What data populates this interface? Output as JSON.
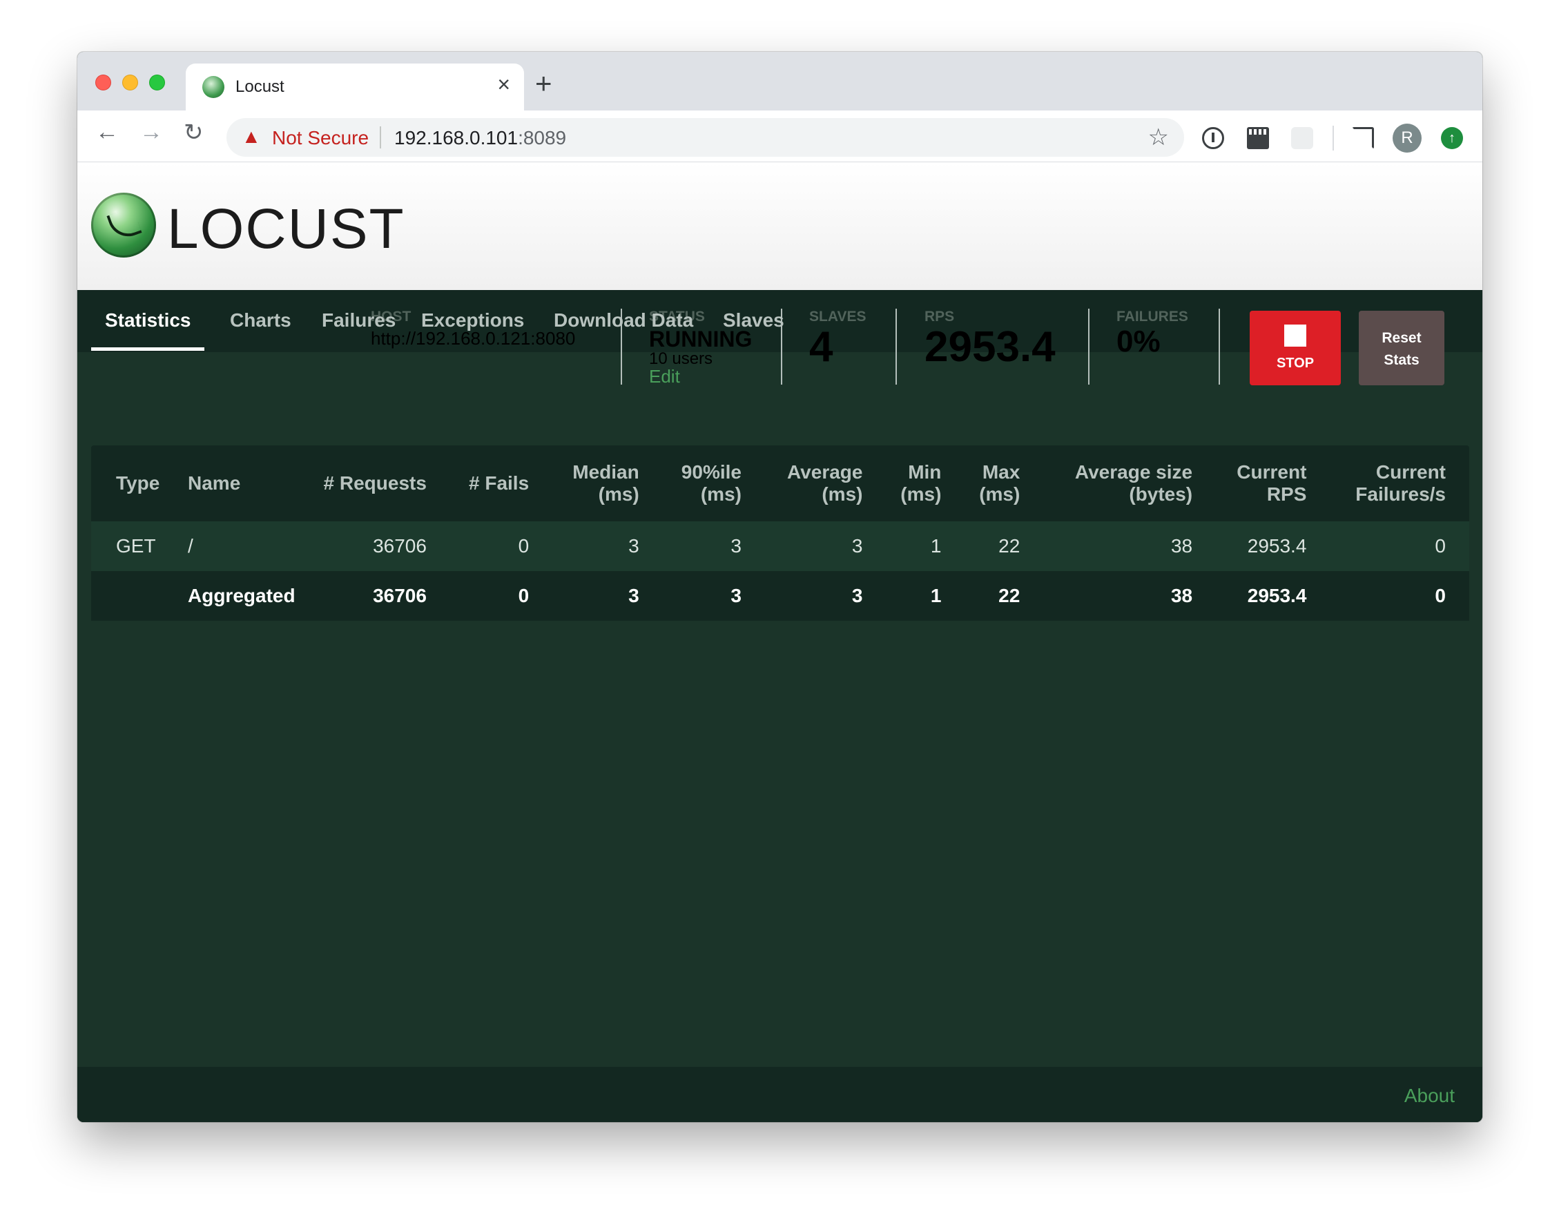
{
  "browser": {
    "tab_title": "Locust",
    "tab_close": "×",
    "new_tab": "+",
    "not_secure": "Not Secure",
    "url_host": "192.168.0.101",
    "url_port": ":8089",
    "avatar_letter": "R"
  },
  "header": {
    "logo_text": "LOCUST",
    "host": {
      "label": "HOST",
      "value": "http://192.168.0.121:8080"
    },
    "status": {
      "label": "STATUS",
      "value": "RUNNING",
      "users": "10 users",
      "edit": "Edit"
    },
    "slaves": {
      "label": "SLAVES",
      "value": "4"
    },
    "rps": {
      "label": "RPS",
      "value": "2953.4"
    },
    "failures": {
      "label": "FAILURES",
      "value": "0%"
    },
    "stop_label": "STOP",
    "reset_label_1": "Reset",
    "reset_label_2": "Stats"
  },
  "tabs": [
    "Statistics",
    "Charts",
    "Failures",
    "Exceptions",
    "Download Data",
    "Slaves"
  ],
  "table": {
    "headers": [
      "Type",
      "Name",
      "# Requests",
      "# Fails",
      "Median (ms)",
      "90%ile (ms)",
      "Average (ms)",
      "Min (ms)",
      "Max (ms)",
      "Average size (bytes)",
      "Current RPS",
      "Current Failures/s"
    ],
    "header_lines": [
      [
        "Type",
        ""
      ],
      [
        "Name",
        ""
      ],
      [
        "# Requests",
        ""
      ],
      [
        "# Fails",
        ""
      ],
      [
        "Median",
        "(ms)"
      ],
      [
        "90%ile",
        "(ms)"
      ],
      [
        "Average",
        "(ms)"
      ],
      [
        "Min",
        "(ms)"
      ],
      [
        "Max",
        "(ms)"
      ],
      [
        "Average size",
        "(bytes)"
      ],
      [
        "Current",
        "RPS"
      ],
      [
        "Current",
        "Failures/s"
      ]
    ],
    "rows": [
      [
        "GET",
        "/",
        "36706",
        "0",
        "3",
        "3",
        "3",
        "1",
        "22",
        "38",
        "2953.4",
        "0"
      ]
    ],
    "aggregated": [
      "",
      "Aggregated",
      "36706",
      "0",
      "3",
      "3",
      "3",
      "1",
      "22",
      "38",
      "2953.4",
      "0"
    ]
  },
  "footer": {
    "about": "About"
  },
  "colors": {
    "stop": "#dd1f26",
    "reset": "#5b4c4c",
    "page_bg": "#1b3429",
    "accent_link": "#4a9f5b"
  }
}
